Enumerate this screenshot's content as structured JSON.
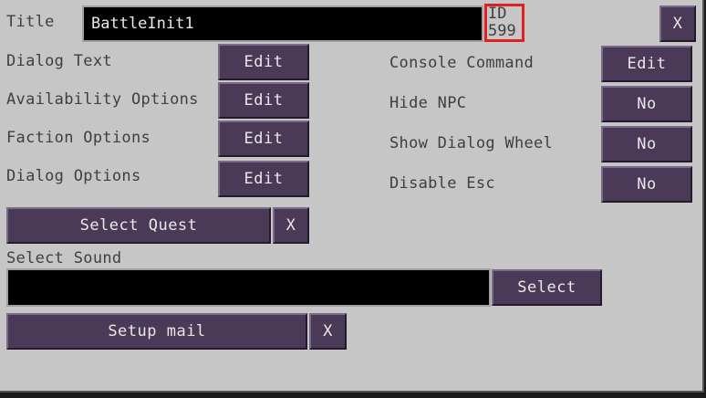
{
  "title_label": "Title",
  "title_value": "BattleInit1",
  "id_label": "ID",
  "id_value": "599",
  "close_label": "X",
  "left_options": [
    {
      "label": "Dialog Text",
      "button": "Edit"
    },
    {
      "label": "Availability Options",
      "button": "Edit"
    },
    {
      "label": "Faction Options",
      "button": "Edit"
    },
    {
      "label": "Dialog Options",
      "button": "Edit"
    }
  ],
  "right_options": [
    {
      "label": "Console Command",
      "button": "Edit"
    },
    {
      "label": "Hide NPC",
      "button": "No"
    },
    {
      "label": "Show Dialog Wheel",
      "button": "No"
    },
    {
      "label": "Disable Esc",
      "button": "No"
    }
  ],
  "quest": {
    "button": "Select Quest",
    "clear": "X"
  },
  "sound": {
    "label": "Select Sound",
    "value": "",
    "button": "Select"
  },
  "mail": {
    "button": "Setup mail",
    "clear": "X"
  }
}
